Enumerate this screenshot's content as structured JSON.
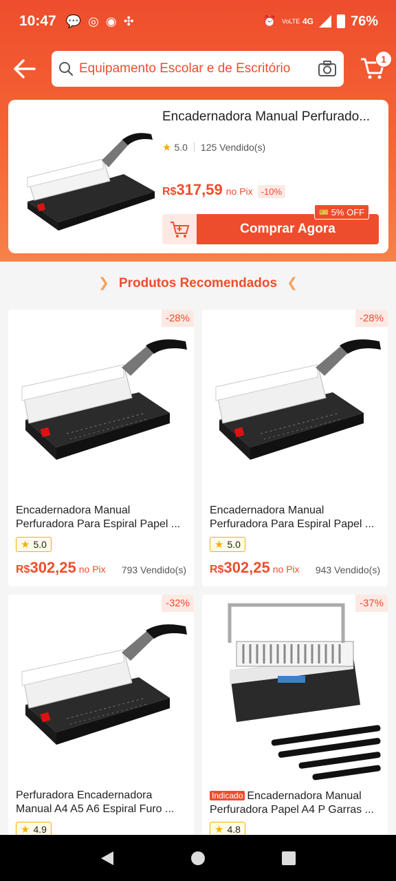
{
  "status": {
    "time": "10:47",
    "network": "4G",
    "volte": "VoLTE",
    "battery": "76%"
  },
  "search": {
    "query": "Equipamento Escolar e de Escritório"
  },
  "cart": {
    "count": "1"
  },
  "hero": {
    "title": "Encadernadora Manual Perfurado...",
    "rating": "5.0",
    "sold": "125 Vendido(s)",
    "currency": "R$",
    "price": "317,59",
    "pix": "no Pix",
    "discount": "-10%",
    "coupon": "5% OFF",
    "buy_label": "Comprar Agora"
  },
  "recommended": {
    "title": "Produtos Recomendados"
  },
  "products": [
    {
      "discount": "-28%",
      "name1": "Encadernadora Manual",
      "name2": "Perfuradora Para Espiral Papel ...",
      "rating": "5.0",
      "currency": "R$",
      "price": "302,25",
      "pix": "no Pix",
      "sold": "793 Vendido(s)"
    },
    {
      "discount": "-28%",
      "name1": "Encadernadora Manual",
      "name2": "Perfuradora Para Espiral Papel ...",
      "rating": "5.0",
      "currency": "R$",
      "price": "302,25",
      "pix": "no Pix",
      "sold": "943 Vendido(s)"
    },
    {
      "discount": "-32%",
      "name1": "Perfuradora Encadernadora",
      "name2": "Manual A4 A5 A6 Espiral Furo ...",
      "rating": "4.9"
    },
    {
      "discount": "-37%",
      "tag": "Indicado",
      "name1": "Encadernadora Manual",
      "name2": "Perfuradora Papel A4 P Garras ...",
      "rating": "4.8"
    }
  ],
  "colors": {
    "brand": "#ee4d2d",
    "star": "#f2b000"
  }
}
